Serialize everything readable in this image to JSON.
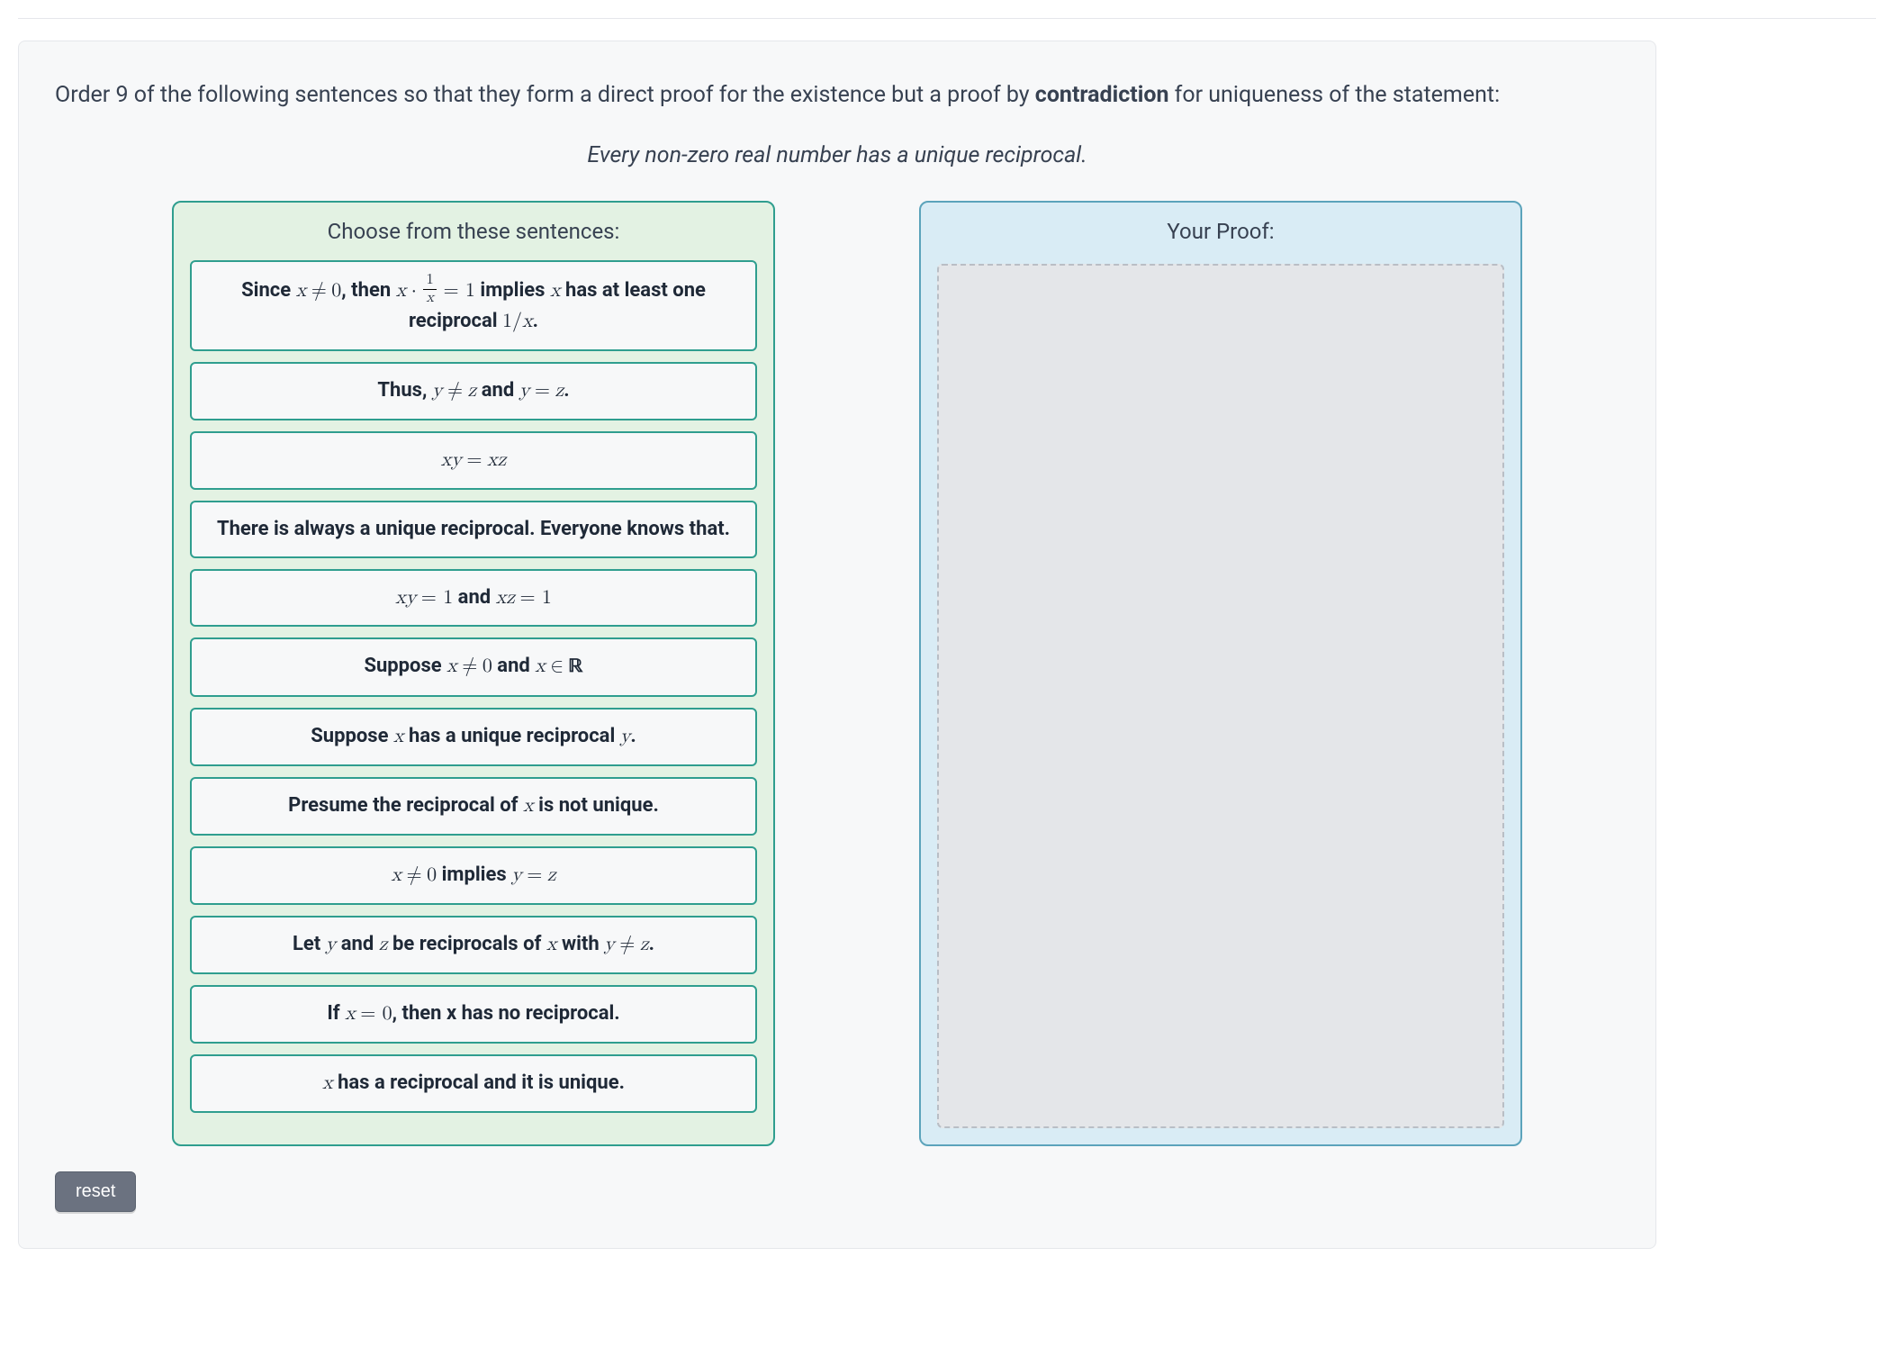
{
  "instructions": {
    "part1": "Order 9 of the following sentences so that they form a direct proof for the existence but a proof by ",
    "bold": "contradiction",
    "part2": " for uniqueness of the statement:"
  },
  "statement": "Every non-zero real number has a unique reciprocal.",
  "panels": {
    "source_title": "Choose from these sentences:",
    "target_title": "Your Proof:"
  },
  "buttons": {
    "reset": "reset"
  },
  "sentences": {
    "0": {
      "p0": "Since ",
      "p1": ", then ",
      "p2": " implies",
      "p3": " has at least one reciprocal ",
      "p4": "."
    },
    "1": {
      "p0": "Thus, ",
      "p1": " and ",
      "p2": "."
    },
    "2": {
      "expr": "xy = xz"
    },
    "3": {
      "p0": "There is always a unique reciprocal. Everyone knows that."
    },
    "4": {
      "p0": " and "
    },
    "5": {
      "p0": "Suppose ",
      "p1": " and "
    },
    "6": {
      "p0": "Suppose ",
      "p1": " has a unique reciprocal ",
      "p2": "."
    },
    "7": {
      "p0": "Presume the reciprocal of ",
      "p1": " is not unique."
    },
    "8": {
      "p0": " implies "
    },
    "9": {
      "p0": "Let ",
      "p1": " and ",
      "p2": " be reciprocals of ",
      "p3": " with ",
      "p4": "."
    },
    "10": {
      "p0": "If ",
      "p1": ", then x has no reciprocal."
    },
    "11": {
      "p0": " has a reciprocal and it is unique."
    }
  },
  "colors": {
    "source_panel_bg": "#e3f2e3",
    "source_panel_border": "#2f9e8f",
    "target_panel_bg": "#d9ecf5",
    "target_panel_border": "#5ba3bb",
    "card_bg": "#f7f8f9",
    "reset_bg": "#6b7280"
  }
}
